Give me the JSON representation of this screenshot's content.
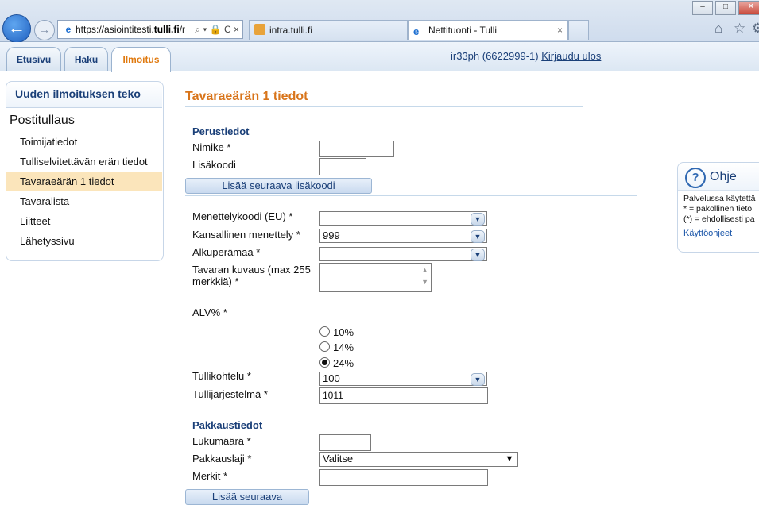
{
  "browser": {
    "url_prefix": "https://asiointitesti.",
    "url_domain": "tulli.fi",
    "url_suffix": "/r",
    "address_tools": "⌕ ▾ 🔒 C ×",
    "tabs": [
      {
        "label": "intra.tulli.fi"
      },
      {
        "label": "Nettituonti - Tulli",
        "close": "×"
      }
    ],
    "window_buttons": [
      "–",
      "□",
      "✕"
    ],
    "toolbar_icons": [
      "home-icon",
      "star-icon"
    ]
  },
  "app_tabs": [
    {
      "label": "Etusivu"
    },
    {
      "label": "Haku"
    },
    {
      "label": "Ilmoitus"
    }
  ],
  "user": {
    "id": "ir33ph (6622999-1)",
    "logout": "Kirjaudu ulos"
  },
  "sidebar": {
    "title": "Uuden ilmoituksen teko",
    "section": "Postitullaus",
    "items": [
      {
        "label": "Toimijatiedot"
      },
      {
        "label": "Tulliselvitettävän erän tiedot"
      },
      {
        "label": "Tavaraeärän 1 tiedot",
        "selected": true
      },
      {
        "label": "Tavaralista"
      },
      {
        "label": "Liitteet"
      },
      {
        "label": "Lähetyssivu"
      }
    ]
  },
  "form": {
    "title": "Tavaraeärän 1 tiedot",
    "basic_section": "Perustiedot",
    "nimike_label": "Nimike *",
    "nimike_value": "",
    "lisakoodi_label": "Lisäkoodi",
    "lisakoodi_value": "",
    "add_code_button": "Lisää seuraava lisäkoodi",
    "procedure_eu_label": "Menettelykoodi (EU) *",
    "procedure_eu_value": "",
    "national_procedure_label": "Kansallinen menettely *",
    "national_procedure_value": "999",
    "origin_label": "Alkuperämaa *",
    "origin_value": "",
    "description_label": "Tavaran kuvaus (max 255 merkkiä) *",
    "description_value": "",
    "vat_label": "ALV%  *",
    "vat_options": [
      {
        "label": "10%",
        "checked": false
      },
      {
        "label": "14%",
        "checked": false
      },
      {
        "label": "24%",
        "checked": true
      }
    ],
    "customs_treatment_label": "Tullikohtelu *",
    "customs_treatment_value": "100",
    "customs_system_label": "Tullijärjestelmä *",
    "customs_system_value": "1011",
    "package_section": "Pakkaustiedot",
    "count_label": "Lukumäärä *",
    "count_value": "",
    "package_type_label": "Pakkauslaji *",
    "package_type_value": "Valitse",
    "marks_label": "Merkit *",
    "marks_value": "",
    "add_next_button": "Lisää seuraava"
  },
  "help": {
    "title": "Ohje",
    "lines": [
      "Palvelussa käytettä",
      "* = pakollinen tieto",
      "(*) = ehdollisesti pa"
    ],
    "link": "Käyttöohjeet"
  }
}
